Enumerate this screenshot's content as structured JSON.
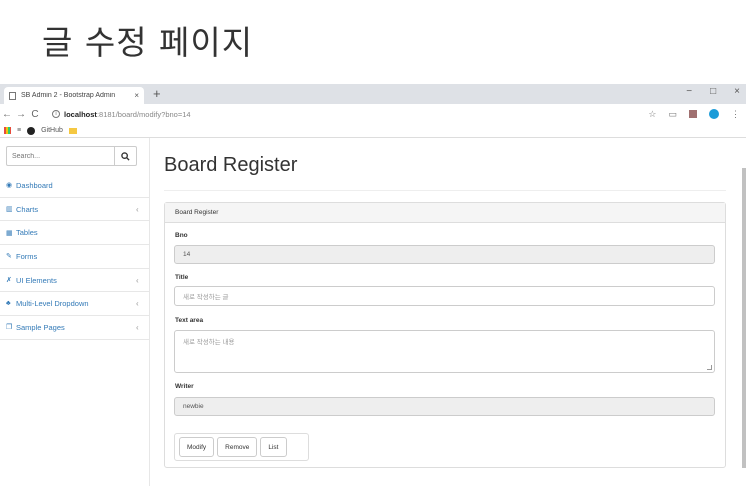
{
  "slide": {
    "title": "글 수정 페이지"
  },
  "browser": {
    "tab_title": "SB Admin 2 - Bootstrap Admin",
    "tab_close": "×",
    "new_tab": "+",
    "controls": {
      "minimize": "−",
      "maximize": "□",
      "close": "×"
    },
    "nav": {
      "back": "←",
      "forward": "→",
      "reload": "C"
    },
    "url_host": "localhost",
    "url_rest": ":8181/board/modify?bno=14",
    "bookmarks": {
      "github": "GitHub"
    }
  },
  "sidebar": {
    "search_placeholder": "Search...",
    "search_icon": "search-icon",
    "items": [
      {
        "label": "Dashboard",
        "icon": "dashboard-icon",
        "arrow": ""
      },
      {
        "label": "Charts",
        "icon": "bar-chart-icon",
        "arrow": "‹"
      },
      {
        "label": "Tables",
        "icon": "table-icon",
        "arrow": ""
      },
      {
        "label": "Forms",
        "icon": "edit-icon",
        "arrow": ""
      },
      {
        "label": "UI Elements",
        "icon": "wrench-icon",
        "arrow": "‹"
      },
      {
        "label": "Multi-Level Dropdown",
        "icon": "sitemap-icon",
        "arrow": "‹"
      },
      {
        "label": "Sample Pages",
        "icon": "files-icon",
        "arrow": "‹"
      }
    ]
  },
  "main": {
    "page_title": "Board Register",
    "panel_heading": "Board Register",
    "form": {
      "bno_label": "Bno",
      "bno_value": "14",
      "title_label": "Title",
      "title_value": "새로 작성하는 글",
      "text_label": "Text area",
      "text_value": "새로 작성하는 내용",
      "writer_label": "Writer",
      "writer_value": "newbie"
    },
    "buttons": {
      "modify": "Modify",
      "remove": "Remove",
      "list": "List"
    }
  }
}
